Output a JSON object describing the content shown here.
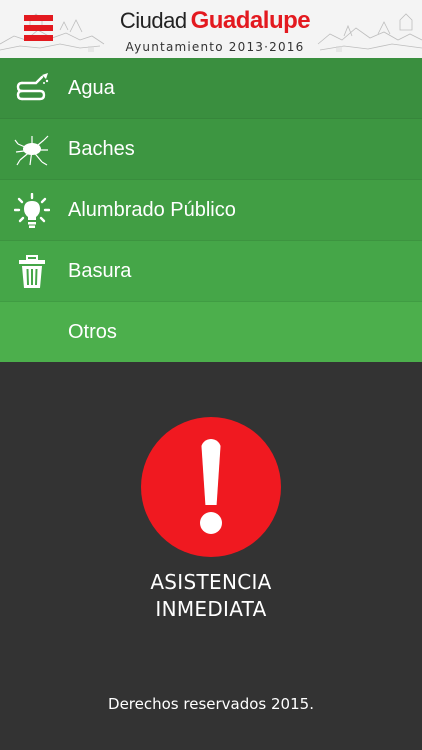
{
  "header": {
    "brand_name_1": "Ciudad",
    "brand_name_2": "Guadalupe",
    "brand_subtitle": "Ayuntamiento 2013·2016",
    "menu_icon": "hamburger-menu-icon",
    "accent_color": "#e3191f"
  },
  "menu": {
    "items": [
      {
        "label": "Agua",
        "icon": "water-hose-icon",
        "color": "#3a8f3f"
      },
      {
        "label": "Baches",
        "icon": "pothole-icon",
        "color": "#3d9641"
      },
      {
        "label": "Alumbrado Público",
        "icon": "light-bulb-icon",
        "color": "#419e44"
      },
      {
        "label": "Basura",
        "icon": "trash-can-icon",
        "color": "#45a648"
      },
      {
        "label": "Otros",
        "icon": "",
        "color": "#4caf4c"
      }
    ]
  },
  "emergency": {
    "button_icon": "exclamation-icon",
    "button_color": "#f01920",
    "line1": "ASISTENCIA",
    "line2": "INMEDIATA"
  },
  "footer": {
    "text": "Derechos reservados 2015."
  }
}
